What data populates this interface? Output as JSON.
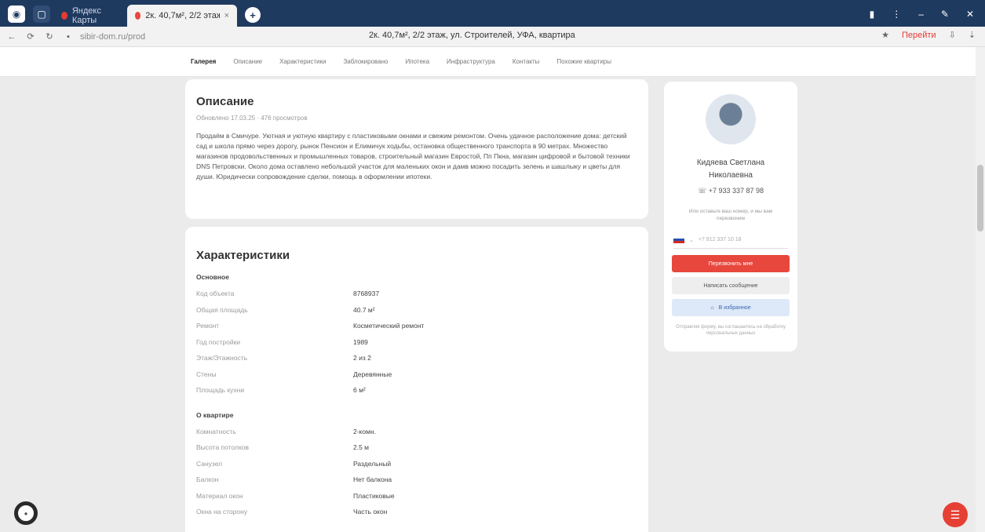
{
  "browser": {
    "tabs": [
      {
        "label": "Яндекс Карты",
        "active": false
      },
      {
        "label": "2к. 40,7м², 2/2 этаж, ул. С",
        "active": true
      }
    ],
    "url": "sibir-dom.ru/prod",
    "page_title": "2к. 40,7м², 2/2 этаж, ул. Строителей, УФА, квартира",
    "ext_label": "Перейти",
    "icons": {
      "back": "arrow-left",
      "forward": "arrow-right",
      "reload": "reload",
      "new_tab": "plus",
      "window": "window-controls"
    }
  },
  "nav": {
    "items": [
      "Галерея",
      "Описание",
      "Характеристики",
      "Заблокировано",
      "Ипотека",
      "Инфраструктура",
      "Контакты",
      "Похожие квартиры"
    ],
    "active_index": 0
  },
  "description": {
    "title": "Описание",
    "meta": "Обновлено 17.03.25 · 476 просмотров",
    "text": "Продаём в Смичуре. Уютная и уютную квартиру с пластиковыми окнами и свежим ремонтом. Очень удачное расположение дома: детский сад и школа прямо через дорогу, рынок Пенсион и Елимичук ходьбы, остановка общественного транспорта в 90 метрах. Множество магазинов продовольственных и промышленных товаров, строительный магазин Евростой, Пп Пкна, магазин цифровой и бытовой техники DNS Петровски. Около дома оставлено небольшой участок для маленьких окон и дамв можно посадить зелень и шашлыку и цветы для души. Юридически сопровождение сделки, помощь в оформлении ипотеки."
  },
  "characteristics": {
    "title": "Характеристики",
    "sections": [
      {
        "name": "Основное",
        "rows": [
          {
            "k": "Код объекта",
            "v": "8768937"
          },
          {
            "k": "Общая площадь",
            "v": "40.7 м²"
          },
          {
            "k": "Ремонт",
            "v": "Косметический ремонт"
          },
          {
            "k": "Год постройки",
            "v": "1989"
          },
          {
            "k": "Этаж/Этажность",
            "v": "2 из 2"
          },
          {
            "k": "Стены",
            "v": "Деревянные"
          },
          {
            "k": "Площадь кухни",
            "v": "6 м²"
          }
        ]
      },
      {
        "name": "О квартире",
        "rows": [
          {
            "k": "Комнатность",
            "v": "2-комн."
          },
          {
            "k": "Высота потолков",
            "v": "2.5 м"
          },
          {
            "k": "Санузел",
            "v": "Раздельный"
          },
          {
            "k": "Балкон",
            "v": "Нет балкона"
          },
          {
            "k": "Материал окон",
            "v": "Пластиковые"
          },
          {
            "k": "Окна на сторону",
            "v": "Часть окон"
          }
        ]
      }
    ]
  },
  "agent": {
    "name_line1": "Кидяева Светлана",
    "name_line2": "Николаевна",
    "phone": "+7 933 337 87 98",
    "note": "Или оставьте ваш номер, и мы вам перезвоним",
    "phone_placeholder": "+7 912 337 10 18",
    "btn_call": "Перезвонить мне",
    "btn_chat": "Написать сообщение",
    "btn_fav": "В избранное",
    "fine": "Отправляя форму, вы соглашаетесь на обработку персональных данных"
  }
}
